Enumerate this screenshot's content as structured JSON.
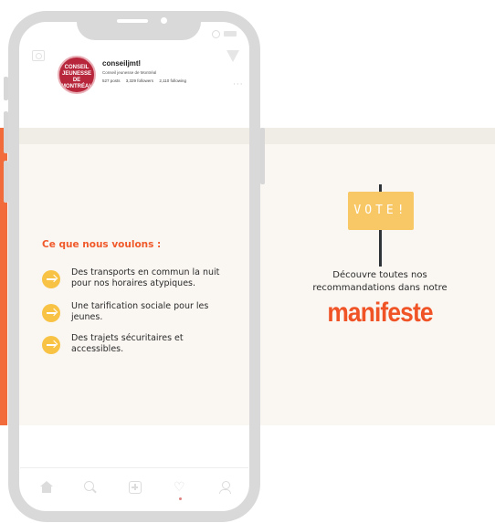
{
  "profile": {
    "avatar_text": "CONSEIL JEUNESSE DE MONTRÉAL",
    "username": "conseiljmtl",
    "bio": "Conseil jeunesse de Montréal",
    "posts": "527 posts",
    "followers": "3,329 followers",
    "following": "2,110 following"
  },
  "content": {
    "title": "Ce que nous voulons :",
    "items": [
      {
        "text": "Des transports en commun la nuit pour nos horaires atypiques."
      },
      {
        "text": "Une tarification sociale pour les jeunes."
      },
      {
        "text": "Des trajets sécuritaires et accessibles."
      }
    ]
  },
  "cta": {
    "sign": "VOTE!",
    "line": "Découvre toutes nos recommandations dans notre",
    "highlight": "manifeste"
  },
  "icons": [
    "camera-icon",
    "send-icon",
    "more-icon",
    "home-icon",
    "search-icon",
    "add-post-icon",
    "heart-icon",
    "profile-icon"
  ],
  "colors": {
    "accent": "#f0592a",
    "bullet": "#f8c244",
    "sign": "#f8c866",
    "brand": "#b7263b",
    "background": "#faf7f3"
  }
}
